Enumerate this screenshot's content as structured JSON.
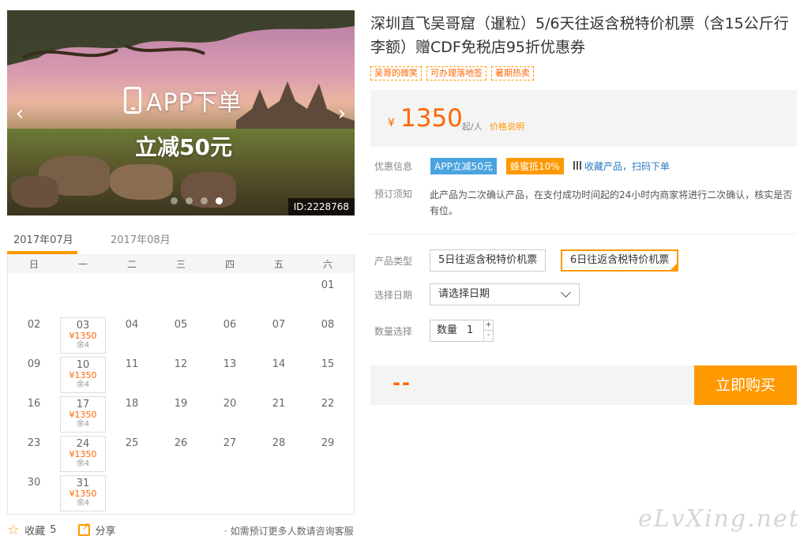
{
  "hero": {
    "promo_line1": "APP下单",
    "promo_line2": "立减50元",
    "prev_arrow": "‹",
    "next_arrow": "›",
    "product_id": "ID:2228768",
    "slide_count": 4,
    "active_slide": 4
  },
  "calendar": {
    "tabs": [
      "2017年07月",
      "2017年08月"
    ],
    "weekdays": [
      "日",
      "一",
      "二",
      "三",
      "四",
      "五",
      "六"
    ],
    "weeks": [
      [
        "",
        "",
        "",
        "",
        "",
        "",
        "01"
      ],
      [
        "02",
        "03",
        "04",
        "05",
        "06",
        "07",
        "08"
      ],
      [
        "09",
        "10",
        "11",
        "12",
        "13",
        "14",
        "15"
      ],
      [
        "16",
        "17",
        "18",
        "19",
        "20",
        "21",
        "22"
      ],
      [
        "23",
        "24",
        "25",
        "26",
        "27",
        "28",
        "29"
      ],
      [
        "30",
        "31",
        "",
        "",
        "",
        "",
        ""
      ]
    ],
    "available": {
      "03": {
        "price": "¥1350",
        "stock": "余4"
      },
      "10": {
        "price": "¥1350",
        "stock": "余4"
      },
      "17": {
        "price": "¥1350",
        "stock": "余4"
      },
      "24": {
        "price": "¥1350",
        "stock": "余4"
      },
      "31": {
        "price": "¥1350",
        "stock": "余4"
      }
    }
  },
  "footer": {
    "favorite_label": "收藏",
    "favorite_count": "5",
    "share_label": "分享",
    "consult_note": "· 如需预订更多人数请咨询客服"
  },
  "product": {
    "title": "深圳直飞吴哥窟（暹粒）5/6天往返含税特价机票（含15公斤行李额）赠CDF免税店95折优惠券",
    "tags": [
      "吴哥的微笑",
      "可办理落地签",
      "暑期热卖"
    ],
    "price_currency": "¥",
    "price_amount": "1350",
    "price_unit": "起/人",
    "price_explain": "价格说明",
    "discount_label": "优惠信息",
    "discount_app": "APP立减50元",
    "discount_honey": "蜂蜜抵10%",
    "discount_links": "收藏产品，扫码下单",
    "booking_label": "预订须知",
    "booking_note": "此产品为二次确认产品，在支付成功时间起的24小时内商家将进行二次确认，核实是否有位。",
    "type_label": "产品类型",
    "type_options": [
      "5日往返含税特价机票",
      "6日往返含税特价机票"
    ],
    "type_selected": 1,
    "date_label": "选择日期",
    "date_placeholder": "请选择日期",
    "qty_label": "数量选择",
    "qty_prefix": "数量",
    "qty_value": "1",
    "qty_plus": "+",
    "qty_minus": "-",
    "total_display": "--",
    "buy_button": "立即购买"
  },
  "watermark": "eLvXing.net",
  "colors": {
    "accent": "#ff9900",
    "price": "#ff6600",
    "link": "#2a7ac1",
    "badge_blue": "#4aa3df"
  }
}
